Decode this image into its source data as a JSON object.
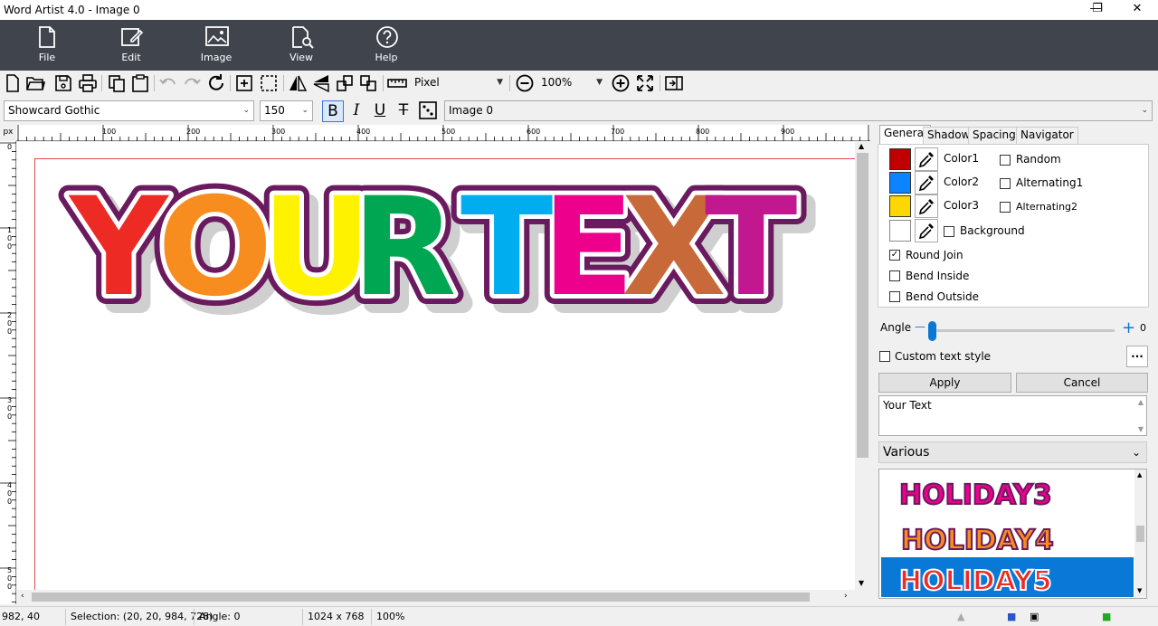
{
  "window": {
    "title": "Word Artist 4.0 - Image 0",
    "minimize": "—",
    "maximize": "❐",
    "close": "✕"
  },
  "ribbon": [
    {
      "label": "File",
      "icon": "file-icon"
    },
    {
      "label": "Edit",
      "icon": "edit-icon"
    },
    {
      "label": "Image",
      "icon": "image-icon"
    },
    {
      "label": "View",
      "icon": "view-icon"
    },
    {
      "label": "Help",
      "icon": "help-icon"
    }
  ],
  "toolbar": {
    "unit": "Pixel",
    "zoom": "100%"
  },
  "format": {
    "font": "Showcard Gothic",
    "size": "150",
    "bold": "B",
    "italic": "I",
    "underline": "U",
    "strike": "T",
    "image_select": "Image 0"
  },
  "ruler": {
    "corner": "px",
    "top_labels": [
      "100",
      "200",
      "300",
      "400",
      "500",
      "600",
      "700",
      "800",
      "900"
    ],
    "left_labels": [
      "0",
      "100",
      "200",
      "300",
      "400",
      "500"
    ]
  },
  "canvas": {
    "art_text": "YOUR TEXT",
    "letters": [
      "Y",
      "O",
      "U",
      "R",
      "T",
      "E",
      "X",
      "T"
    ]
  },
  "colors": {
    "letters": [
      "#ee2a24",
      "#f78d1e",
      "#fff200",
      "#00a651",
      "#00aeef",
      "#ec008c",
      "#c8693a",
      "#c2188f"
    ],
    "outline": "#6a1a5e",
    "color1": "#c00000",
    "color2": "#0a84ff",
    "color3": "#ffd700",
    "background": "#ffffff",
    "accent": "#0a78d7"
  },
  "panel": {
    "tabs": [
      "General",
      "Shadow",
      "Spacing",
      "Navigator"
    ],
    "color_labels": [
      "Color1",
      "Color2",
      "Color3"
    ],
    "random": "Random",
    "alt1": "Alternating1",
    "alt2": "Alternating2",
    "background": "Background",
    "round_join": "Round Join",
    "bend_inside": "Bend Inside",
    "bend_outside": "Bend Outside",
    "round_join_checked": true,
    "angle_label": "Angle",
    "angle_value": "0",
    "angle_minus": "—",
    "angle_plus": "+",
    "custom_style": "Custom text style",
    "more": "...",
    "apply": "Apply",
    "cancel": "Cancel",
    "text_value": "Your Text",
    "category": "Various",
    "styles": [
      "HOLIDAY3",
      "HOLIDAY4",
      "HOLIDAY5"
    ]
  },
  "status": {
    "coords": "982, 40",
    "selection": "Selection: (20, 20, 984, 728)",
    "angle": "Angle: 0",
    "size": "1024 x 768",
    "zoom": "100%"
  }
}
